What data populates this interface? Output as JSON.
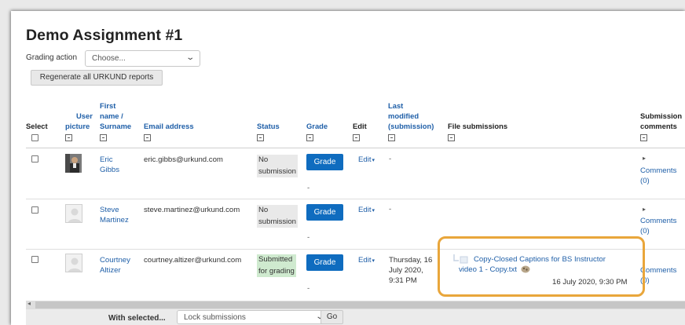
{
  "page": {
    "title": "Demo Assignment #1"
  },
  "grading_action": {
    "label": "Grading action",
    "selected": "Choose..."
  },
  "regenerate_button": "Regenerate all URKUND reports",
  "columns": {
    "select": "Select",
    "user_picture_1": "User",
    "user_picture_2": "picture",
    "name_1": "First",
    "name_2": "name /",
    "name_3": "Surname",
    "email": "Email address",
    "status": "Status",
    "grade": "Grade",
    "edit": "Edit",
    "modified_1": "Last",
    "modified_2": "modified",
    "modified_3": "(submission)",
    "files": "File submissions",
    "comments_1": "Submission",
    "comments_2": "comments"
  },
  "rows": [
    {
      "first": "Eric",
      "last": "Gibbs",
      "email": "eric.gibbs@urkund.com",
      "status_1": "No",
      "status_2": "submission",
      "grade_button": "Grade",
      "grade_value": "-",
      "edit": "Edit",
      "modified": "-",
      "comments_arrow": "▸",
      "comments_1": "Comments",
      "comments_2": "(0)"
    },
    {
      "first": "Steve",
      "last": "Martinez",
      "email": "steve.martinez@urkund.com",
      "status_1": "No",
      "status_2": "submission",
      "grade_button": "Grade",
      "grade_value": "-",
      "edit": "Edit",
      "modified": "-",
      "comments_arrow": "▸",
      "comments_1": "Comments",
      "comments_2": "(0)"
    },
    {
      "first": "Courtney",
      "last": "Altizer",
      "email": "courtney.altizer@urkund.com",
      "status_1": "Submitted",
      "status_2": "for grading",
      "grade_button": "Grade",
      "grade_value": "-",
      "edit": "Edit",
      "modified_1": "Thursday, 16",
      "modified_2": "July 2020,",
      "modified_3": "9:31 PM",
      "file_name_1": "Copy-Closed Captions for BS Instructor",
      "file_name_2": "video 1 - Copy.txt",
      "file_date": "16 July 2020, 9:30 PM",
      "comments_1": "Comments",
      "comments_2": "(0)"
    }
  ],
  "bulk": {
    "label": "With selected...",
    "selected": "Lock submissions",
    "go": "Go"
  },
  "colors": {
    "link": "#1f5fa8",
    "grade_button": "#0f6cbf",
    "highlight": "#e9a63b",
    "submitted_bg": "#cfeacf"
  }
}
